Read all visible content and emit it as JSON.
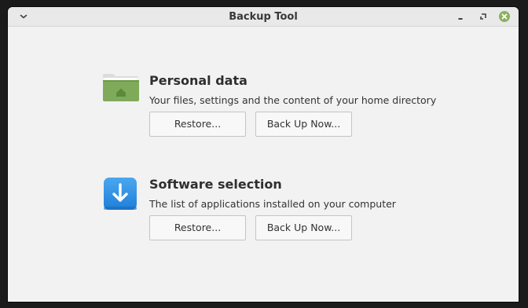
{
  "window": {
    "title": "Backup Tool"
  },
  "sections": [
    {
      "title": "Personal data",
      "description": "Your files, settings and the content of your home directory",
      "icon": "folder-home-icon",
      "restore_label": "Restore...",
      "backup_label": "Back Up Now..."
    },
    {
      "title": "Software selection",
      "description": "The list of applications installed on your computer",
      "icon": "download-arrow-icon",
      "restore_label": "Restore...",
      "backup_label": "Back Up Now..."
    }
  ],
  "colors": {
    "accent_green": "#7faa5a",
    "accent_blue": "#2b8fe4",
    "close_button": "#8ab25d"
  }
}
